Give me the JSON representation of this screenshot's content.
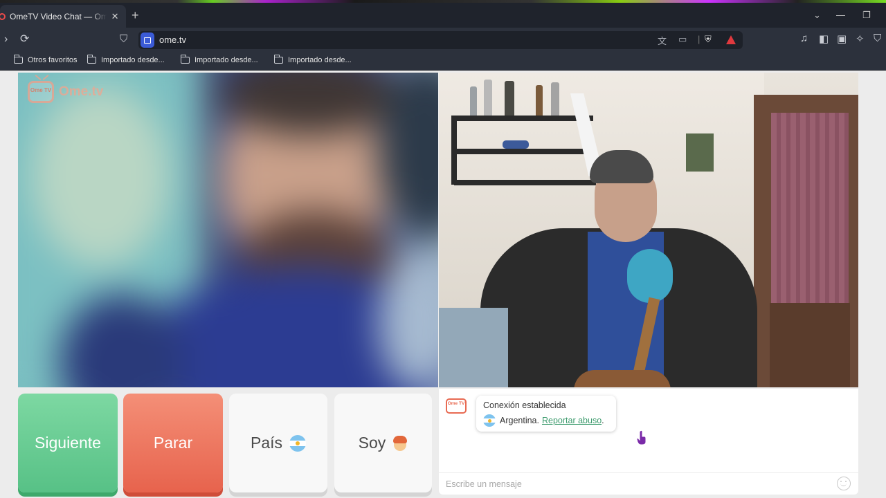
{
  "browser": {
    "tab_title": "OmeTV Video Chat — Omegle",
    "tab_close": "✕",
    "new_tab": "+",
    "url": "ome.tv",
    "bookmarks": [
      "Otros favoritos",
      "Importado desde...",
      "Importado desde...",
      "Importado desde..."
    ]
  },
  "page": {
    "logo_icon_text": "Ome TV",
    "logo_text": "Ome.tv",
    "controls": {
      "next_label": "Siguiente",
      "stop_label": "Parar",
      "country_label": "País",
      "gender_label": "Soy"
    },
    "chat": {
      "logo_text": "Ome TV",
      "status_text": "Conexión establecida",
      "country_text": "Argentina.",
      "report_link": "Reportar abuso",
      "report_suffix": ".",
      "message_placeholder": "Escribe un mensaje"
    }
  },
  "colors": {
    "next_button": "#57c186",
    "stop_button": "#e7634d",
    "link_green": "#3b9a6c",
    "brand_orange": "#e86a52"
  },
  "icons": {
    "country_flag": "argentina-flag-icon",
    "gender": "boy-emoji-icon",
    "emoji_button": "smiley-icon"
  }
}
